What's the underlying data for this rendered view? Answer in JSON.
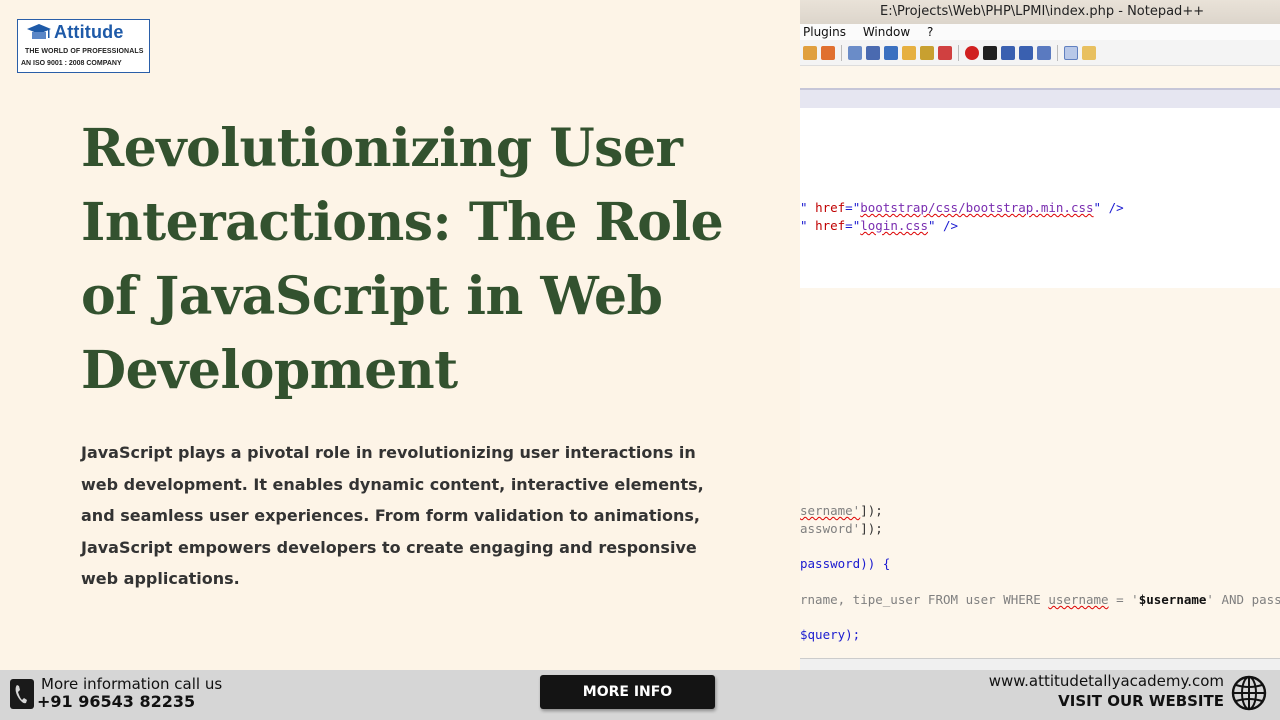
{
  "logo": {
    "brand": "Attitude",
    "tagline": "THE WORLD OF PROFESSIONALS",
    "certification": "AN ISO 9001 : 2008 COMPANY"
  },
  "headline": "Revolutionizing User Interactions: The Role of JavaScript in Web Development",
  "description": "JavaScript plays a pivotal role in revolutionizing user interactions in web development. It enables dynamic content, interactive elements, and seamless user experiences. From form validation to animations, JavaScript empowers developers to create engaging and responsive web applications.",
  "editor": {
    "title": "E:\\Projects\\Web\\PHP\\LPMI\\index.php - Notepad++",
    "menu": [
      "Plugins",
      "Window",
      "?"
    ],
    "code": {
      "css1": "bootstrap/css/bootstrap.min.css",
      "css2": "login.css",
      "user_var": "sername'",
      "pass_var": "assword'",
      "cond": "password)) {",
      "query_start": "rname, tipe_user FROM user WHERE ",
      "query_col": "username",
      "query_mid": " = '",
      "query_var": "$username",
      "query_end": "' AND passw",
      "query_call": "$query);"
    }
  },
  "footer": {
    "call_label": "More information call us",
    "phone": "+91 96543 82235",
    "more_info": "MORE INFO",
    "website": "www.attitudetallyacademy.com",
    "visit_label": "VISIT OUR WEBSITE"
  },
  "colors": {
    "background": "#fdf4e7",
    "headline": "#33522f",
    "brand": "#1e5aa8"
  }
}
